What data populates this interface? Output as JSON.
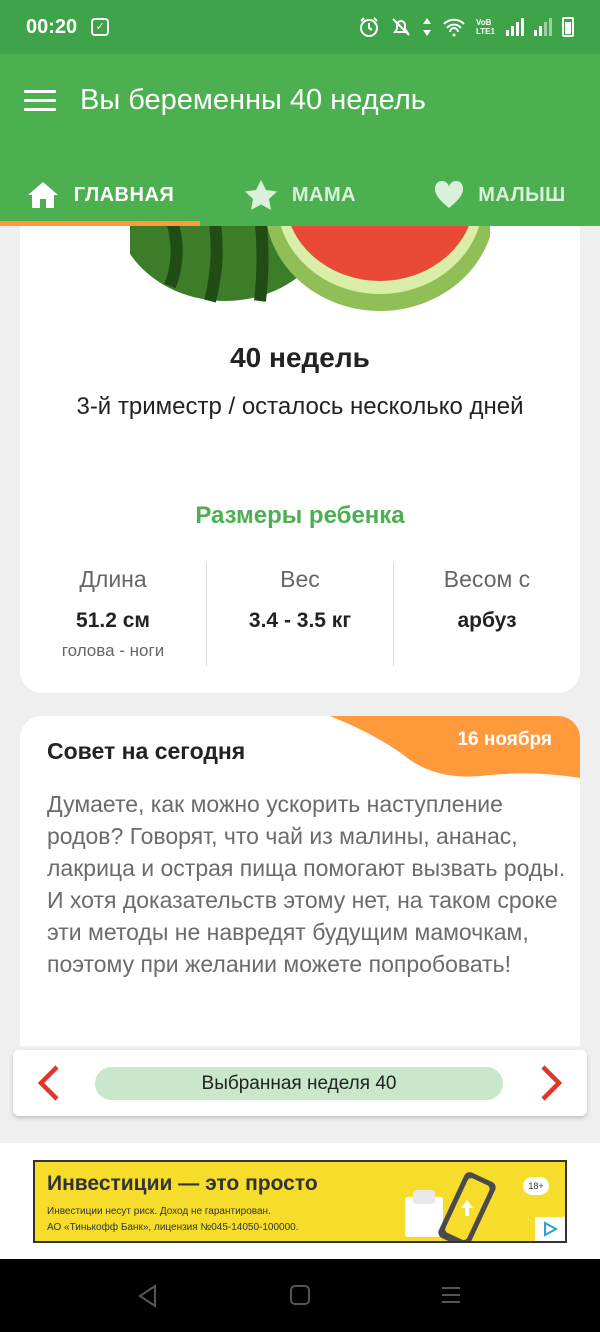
{
  "status_bar": {
    "time": "00:20",
    "network_badge": "VoB LTE1",
    "icons": [
      "alarm-icon",
      "mute-icon",
      "data-icon",
      "wifi-icon",
      "signal-icon",
      "battery-icon"
    ]
  },
  "app_bar": {
    "title": "Вы беременны 40 недель",
    "tabs": [
      {
        "label": "ГЛАВНАЯ",
        "icon": "home-icon",
        "active": true
      },
      {
        "label": "МАМА",
        "icon": "star-icon",
        "active": false
      },
      {
        "label": "МАЛЫШ",
        "icon": "heart-icon",
        "active": false
      }
    ]
  },
  "week_card": {
    "week_title": "40 недель",
    "subtitle": "3-й триместр / осталось несколько дней",
    "sizes_heading": "Размеры ребенка",
    "stats": [
      {
        "label": "Длина",
        "value": "51.2 см",
        "note": "голова - ноги"
      },
      {
        "label": "Вес",
        "value": "3.4 - 3.5 кг",
        "note": ""
      },
      {
        "label": "Весом с",
        "value": "арбуз",
        "note": ""
      }
    ]
  },
  "tip_card": {
    "title": "Совет на сегодня",
    "date": "16 ноября",
    "text": "Думаете, как можно ускорить наступление родов? Говорят, что чай из малины, ананас, лакрица и острая пища помогают вызвать роды. И хотя доказательств этому нет, на таком сроке эти методы не навредят будущим мамочкам, поэтому при желании можете попробовать!"
  },
  "week_nav": {
    "label": "Выбранная неделя 40"
  },
  "ad": {
    "headline": "Инвестиции — это просто",
    "line1": "Инвестиции несут риск. Доход не гарантирован.",
    "line2": "АО «Тинькофф Банк», лицензия №045-14050-100000.",
    "age": "18+"
  },
  "colors": {
    "status_bar": "#3fa34a",
    "app_bar": "#4cb050",
    "accent_orange": "#ff9a3c",
    "pill": "#c9e7cb",
    "arrow_red": "#e0352b",
    "ad_yellow": "#f6dd2b"
  }
}
